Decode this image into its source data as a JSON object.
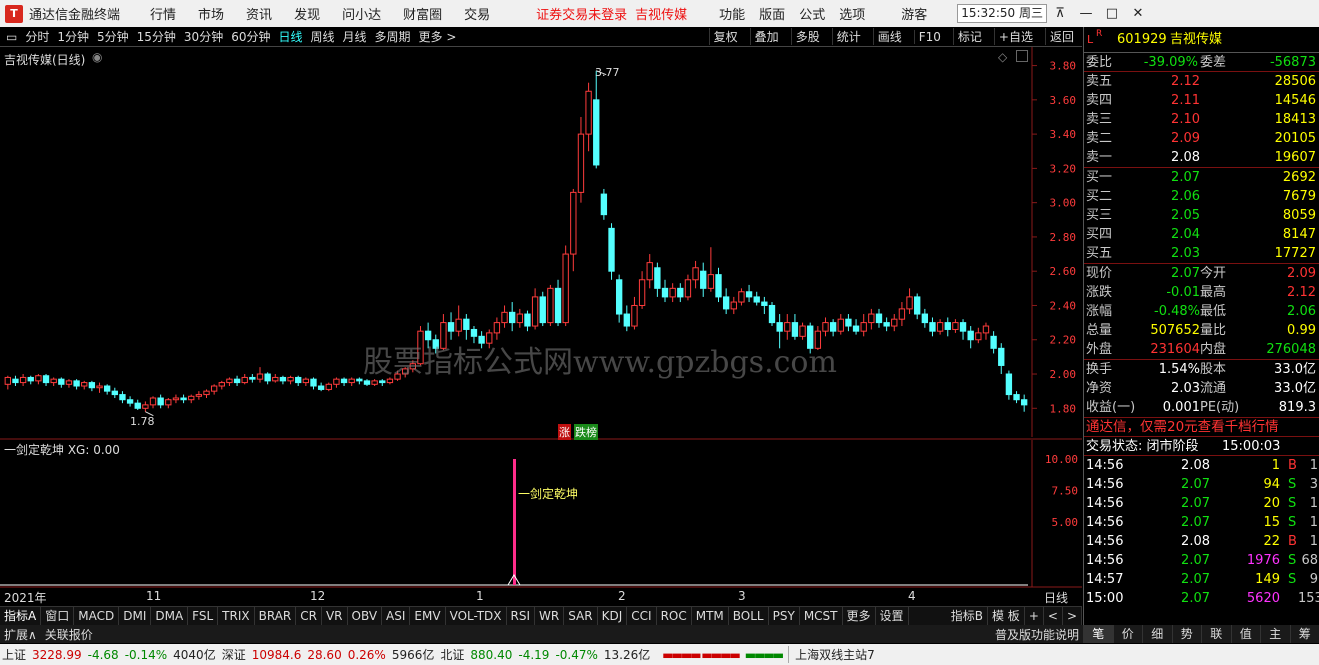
{
  "titlebar": {
    "logo": "T",
    "app": "通达信金融终端",
    "menus": [
      "行情",
      "市场",
      "资讯",
      "发现",
      "问小达",
      "财富圈",
      "交易"
    ],
    "warning": "证券交易未登录",
    "stock": "吉视传媒",
    "tools": [
      "功能",
      "版面",
      "公式",
      "选项"
    ],
    "guest": "游客",
    "clock": "15:32:50 周三"
  },
  "toolbar": {
    "periods": [
      "分时",
      "1分钟",
      "5分钟",
      "15分钟",
      "30分钟",
      "60分钟",
      "日线",
      "周线",
      "月线",
      "多周期",
      "更多 >"
    ],
    "selected": "日线",
    "right": [
      "复权",
      "叠加",
      "多股",
      "统计",
      "画线",
      "F10",
      "标记",
      "+自选",
      "返回"
    ]
  },
  "chart": {
    "title": "吉视传媒(日线)",
    "high_label": "3.77",
    "low_label": "1.78",
    "zhang_label": "涨",
    "tingpai_label": "跌榜",
    "ind_title": "一剑定乾坤 XG: 0.00",
    "signal_label": "一剑定乾坤",
    "date_labels": [
      "2021年",
      "11",
      "12",
      "1",
      "2",
      "3",
      "4"
    ],
    "period_box": "日线",
    "watermark": "股票指标公式网www.gpzbgs.com"
  },
  "chart_data": {
    "type": "candlestick",
    "price_ticks": [
      "3.80",
      "3.60",
      "3.40",
      "3.20",
      "3.00",
      "2.80",
      "2.60",
      "2.40",
      "2.20",
      "2.00",
      "1.80"
    ],
    "ind_ticks": [
      "10.00",
      "7.50",
      "5.00"
    ],
    "ylim": [
      1.72,
      3.85
    ],
    "high": 3.77,
    "low": 1.78,
    "xg_signal": {
      "value": 10.0
    },
    "candles": [
      [
        1.94,
        1.98,
        1.99,
        1.91
      ],
      [
        1.97,
        1.95,
        1.99,
        1.93
      ],
      [
        1.95,
        1.98,
        2.0,
        1.93
      ],
      [
        1.98,
        1.96,
        1.99,
        1.94
      ],
      [
        1.96,
        1.99,
        2.0,
        1.94
      ],
      [
        1.99,
        1.95,
        2.0,
        1.93
      ],
      [
        1.95,
        1.97,
        1.98,
        1.93
      ],
      [
        1.97,
        1.94,
        1.98,
        1.92
      ],
      [
        1.94,
        1.96,
        1.97,
        1.92
      ],
      [
        1.96,
        1.93,
        1.97,
        1.91
      ],
      [
        1.93,
        1.95,
        1.96,
        1.91
      ],
      [
        1.95,
        1.92,
        1.96,
        1.9
      ],
      [
        1.92,
        1.93,
        1.95,
        1.89
      ],
      [
        1.93,
        1.9,
        1.94,
        1.88
      ],
      [
        1.9,
        1.88,
        1.92,
        1.86
      ],
      [
        1.88,
        1.85,
        1.9,
        1.83
      ],
      [
        1.85,
        1.83,
        1.87,
        1.81
      ],
      [
        1.83,
        1.8,
        1.85,
        1.79
      ],
      [
        1.8,
        1.82,
        1.84,
        1.78
      ],
      [
        1.82,
        1.86,
        1.87,
        1.8
      ],
      [
        1.86,
        1.82,
        1.88,
        1.8
      ],
      [
        1.82,
        1.85,
        1.86,
        1.8
      ],
      [
        1.85,
        1.86,
        1.88,
        1.83
      ],
      [
        1.86,
        1.85,
        1.88,
        1.83
      ],
      [
        1.85,
        1.87,
        1.88,
        1.83
      ],
      [
        1.87,
        1.88,
        1.9,
        1.85
      ],
      [
        1.88,
        1.9,
        1.91,
        1.86
      ],
      [
        1.9,
        1.93,
        1.94,
        1.88
      ],
      [
        1.93,
        1.95,
        1.96,
        1.91
      ],
      [
        1.95,
        1.97,
        1.98,
        1.93
      ],
      [
        1.97,
        1.95,
        1.99,
        1.93
      ],
      [
        1.95,
        1.98,
        2.0,
        1.94
      ],
      [
        1.98,
        1.97,
        2.0,
        1.95
      ],
      [
        1.97,
        2.0,
        2.04,
        1.95
      ],
      [
        2.0,
        1.96,
        2.01,
        1.94
      ],
      [
        1.96,
        1.98,
        2.0,
        1.95
      ],
      [
        1.98,
        1.96,
        1.99,
        1.94
      ],
      [
        1.96,
        1.98,
        1.99,
        1.94
      ],
      [
        1.98,
        1.95,
        1.99,
        1.93
      ],
      [
        1.95,
        1.97,
        1.98,
        1.93
      ],
      [
        1.97,
        1.93,
        1.98,
        1.91
      ],
      [
        1.93,
        1.91,
        1.95,
        1.9
      ],
      [
        1.91,
        1.94,
        1.95,
        1.9
      ],
      [
        1.94,
        1.97,
        1.98,
        1.92
      ],
      [
        1.97,
        1.95,
        1.98,
        1.93
      ],
      [
        1.95,
        1.97,
        1.98,
        1.93
      ],
      [
        1.97,
        1.96,
        1.98,
        1.94
      ],
      [
        1.96,
        1.94,
        1.97,
        1.93
      ],
      [
        1.94,
        1.96,
        1.97,
        1.93
      ],
      [
        1.96,
        1.95,
        1.97,
        1.93
      ],
      [
        1.95,
        1.97,
        1.98,
        1.94
      ],
      [
        1.97,
        2.0,
        2.02,
        1.96
      ],
      [
        2.0,
        2.03,
        2.04,
        1.98
      ],
      [
        2.03,
        2.06,
        2.08,
        2.01
      ],
      [
        2.06,
        2.25,
        2.28,
        2.05
      ],
      [
        2.25,
        2.2,
        2.3,
        2.15
      ],
      [
        2.2,
        2.15,
        2.23,
        2.12
      ],
      [
        2.15,
        2.3,
        2.35,
        2.14
      ],
      [
        2.3,
        2.25,
        2.36,
        2.2
      ],
      [
        2.25,
        2.32,
        2.4,
        2.22
      ],
      [
        2.32,
        2.26,
        2.35,
        2.2
      ],
      [
        2.26,
        2.22,
        2.28,
        2.18
      ],
      [
        2.22,
        2.18,
        2.25,
        2.15
      ],
      [
        2.18,
        2.24,
        2.26,
        2.15
      ],
      [
        2.24,
        2.3,
        2.33,
        2.2
      ],
      [
        2.3,
        2.36,
        2.4,
        2.27
      ],
      [
        2.36,
        2.3,
        2.42,
        2.25
      ],
      [
        2.3,
        2.35,
        2.38,
        2.27
      ],
      [
        2.35,
        2.28,
        2.37,
        2.25
      ],
      [
        2.28,
        2.45,
        2.5,
        2.26
      ],
      [
        2.45,
        2.3,
        2.48,
        2.28
      ],
      [
        2.3,
        2.5,
        2.52,
        2.28
      ],
      [
        2.5,
        2.3,
        2.55,
        2.28
      ],
      [
        2.3,
        2.7,
        2.75,
        2.28
      ],
      [
        2.7,
        3.06,
        3.08,
        2.6
      ],
      [
        3.06,
        3.4,
        3.5,
        3.0
      ],
      [
        3.4,
        3.65,
        3.7,
        3.3
      ],
      [
        3.6,
        3.22,
        3.77,
        3.2
      ],
      [
        3.05,
        2.93,
        3.08,
        2.9
      ],
      [
        2.85,
        2.6,
        2.88,
        2.55
      ],
      [
        2.55,
        2.35,
        2.58,
        2.3
      ],
      [
        2.35,
        2.28,
        2.4,
        2.25
      ],
      [
        2.28,
        2.4,
        2.45,
        2.26
      ],
      [
        2.4,
        2.55,
        2.6,
        2.38
      ],
      [
        2.55,
        2.65,
        2.7,
        2.5
      ],
      [
        2.62,
        2.5,
        2.65,
        2.45
      ],
      [
        2.5,
        2.45,
        2.55,
        2.42
      ],
      [
        2.45,
        2.5,
        2.53,
        2.42
      ],
      [
        2.5,
        2.45,
        2.53,
        2.42
      ],
      [
        2.45,
        2.55,
        2.58,
        2.43
      ],
      [
        2.55,
        2.62,
        2.66,
        2.5
      ],
      [
        2.6,
        2.5,
        2.65,
        2.45
      ],
      [
        2.5,
        2.58,
        2.74,
        2.48
      ],
      [
        2.58,
        2.45,
        2.62,
        2.42
      ],
      [
        2.45,
        2.38,
        2.5,
        2.35
      ],
      [
        2.38,
        2.42,
        2.45,
        2.35
      ],
      [
        2.42,
        2.48,
        2.5,
        2.4
      ],
      [
        2.48,
        2.45,
        2.52,
        2.42
      ],
      [
        2.45,
        2.42,
        2.48,
        2.4
      ],
      [
        2.42,
        2.4,
        2.45,
        2.35
      ],
      [
        2.4,
        2.3,
        2.42,
        2.28
      ],
      [
        2.3,
        2.25,
        2.35,
        2.15
      ],
      [
        2.25,
        2.3,
        2.35,
        2.2
      ],
      [
        2.3,
        2.22,
        2.35,
        2.2
      ],
      [
        2.22,
        2.28,
        2.3,
        2.2
      ],
      [
        2.28,
        2.15,
        2.3,
        2.12
      ],
      [
        2.15,
        2.25,
        2.28,
        2.14
      ],
      [
        2.25,
        2.3,
        2.33,
        2.22
      ],
      [
        2.3,
        2.25,
        2.32,
        2.22
      ],
      [
        2.25,
        2.32,
        2.35,
        2.23
      ],
      [
        2.32,
        2.28,
        2.35,
        2.25
      ],
      [
        2.28,
        2.25,
        2.32,
        2.23
      ],
      [
        2.25,
        2.3,
        2.35,
        2.22
      ],
      [
        2.3,
        2.35,
        2.38,
        2.26
      ],
      [
        2.35,
        2.3,
        2.38,
        2.27
      ],
      [
        2.3,
        2.28,
        2.33,
        2.25
      ],
      [
        2.28,
        2.32,
        2.35,
        2.25
      ],
      [
        2.32,
        2.38,
        2.42,
        2.28
      ],
      [
        2.38,
        2.45,
        2.5,
        2.35
      ],
      [
        2.45,
        2.35,
        2.47,
        2.32
      ],
      [
        2.35,
        2.3,
        2.38,
        2.27
      ],
      [
        2.3,
        2.25,
        2.33,
        2.22
      ],
      [
        2.25,
        2.3,
        2.32,
        2.23
      ],
      [
        2.3,
        2.26,
        2.33,
        2.22
      ],
      [
        2.26,
        2.3,
        2.32,
        2.24
      ],
      [
        2.3,
        2.25,
        2.32,
        2.2
      ],
      [
        2.25,
        2.2,
        2.28,
        2.15
      ],
      [
        2.2,
        2.24,
        2.27,
        2.18
      ],
      [
        2.24,
        2.28,
        2.3,
        2.2
      ],
      [
        2.22,
        2.15,
        2.25,
        2.12
      ],
      [
        2.15,
        2.05,
        2.18,
        2.0
      ],
      [
        2.0,
        1.88,
        2.02,
        1.85
      ],
      [
        1.88,
        1.85,
        1.9,
        1.83
      ],
      [
        1.85,
        1.82,
        1.88,
        1.78
      ]
    ]
  },
  "right": {
    "code": "601929",
    "name": "吉视传媒",
    "weibi_label": "委比",
    "weibi": "-39.09%",
    "weicha_label": "委差",
    "weicha": "-56873",
    "asks": [
      {
        "label": "卖五",
        "price": "2.12",
        "vol": "28506"
      },
      {
        "label": "卖四",
        "price": "2.11",
        "vol": "14546"
      },
      {
        "label": "卖三",
        "price": "2.10",
        "vol": "18413"
      },
      {
        "label": "卖二",
        "price": "2.09",
        "vol": "20105"
      },
      {
        "label": "卖一",
        "price": "2.08",
        "vol": "19607"
      }
    ],
    "bids": [
      {
        "label": "买一",
        "price": "2.07",
        "vol": "2692"
      },
      {
        "label": "买二",
        "price": "2.06",
        "vol": "7679"
      },
      {
        "label": "买三",
        "price": "2.05",
        "vol": "8059"
      },
      {
        "label": "买四",
        "price": "2.04",
        "vol": "8147"
      },
      {
        "label": "买五",
        "price": "2.03",
        "vol": "17727"
      }
    ],
    "stats": [
      [
        "现价",
        "2.07",
        "今开",
        "2.09"
      ],
      [
        "涨跌",
        "-0.01",
        "最高",
        "2.12"
      ],
      [
        "涨幅",
        "-0.48%",
        "最低",
        "2.06"
      ],
      [
        "总量",
        "507652",
        "量比",
        "0.99"
      ],
      [
        "外盘",
        "231604",
        "内盘",
        "276048"
      ]
    ],
    "stats2": [
      [
        "换手",
        "1.54%",
        "股本",
        "33.0亿"
      ],
      [
        "净资",
        "2.03",
        "流通",
        "33.0亿"
      ],
      [
        "收益(一)",
        "0.001",
        "PE(动)",
        "819.3"
      ]
    ],
    "promo": "通达信，仅需20元查看千档行情",
    "trade_state": "交易状态: 闭市阶段",
    "trade_time": "15:00:03",
    "ticks": [
      [
        "14:56",
        "2.08",
        "1",
        "B",
        "1"
      ],
      [
        "14:56",
        "2.07",
        "94",
        "S",
        "3"
      ],
      [
        "14:56",
        "2.07",
        "20",
        "S",
        "1"
      ],
      [
        "14:56",
        "2.07",
        "15",
        "S",
        "1"
      ],
      [
        "14:56",
        "2.08",
        "22",
        "B",
        "1"
      ],
      [
        "14:56",
        "2.07",
        "1976",
        "S",
        "68"
      ],
      [
        "14:57",
        "2.07",
        "149",
        "S",
        "9"
      ],
      [
        "15:00",
        "2.07",
        "5620",
        "",
        "153"
      ]
    ],
    "sidetabs": [
      "笔",
      "价",
      "细",
      "势",
      "联",
      "值",
      "主",
      "筹"
    ]
  },
  "bottomtabs": [
    "指标A",
    "窗口",
    "MACD",
    "DMI",
    "DMA",
    "FSL",
    "TRIX",
    "BRAR",
    "CR",
    "VR",
    "OBV",
    "ASI",
    "EMV",
    "VOL-TDX",
    "RSI",
    "WR",
    "SAR",
    "KDJ",
    "CCI",
    "ROC",
    "MTM",
    "BOLL",
    "PSY",
    "MCST",
    "更多",
    "设置"
  ],
  "bottomright": [
    "指标B",
    "模 板",
    "+",
    "<",
    ">"
  ],
  "subtabs": {
    "left": [
      "扩展∧",
      "关联报价"
    ],
    "right": "普及版功能说明"
  },
  "status": {
    "sh_label": "上证",
    "sh": "3228.99",
    "sh_chg": "-4.68",
    "sh_pct": "-0.14%",
    "sh_amt": "4040亿",
    "sz_label": "深证",
    "sz": "10984.6",
    "sz_chg": "28.60",
    "sz_pct": "0.26%",
    "sz_amt": "5966亿",
    "bz_label": "北证",
    "bz": "880.40",
    "bz_chg": "-4.19",
    "bz_pct": "-0.47%",
    "bz_amt": "13.26亿",
    "server": "上海双线主站7"
  }
}
